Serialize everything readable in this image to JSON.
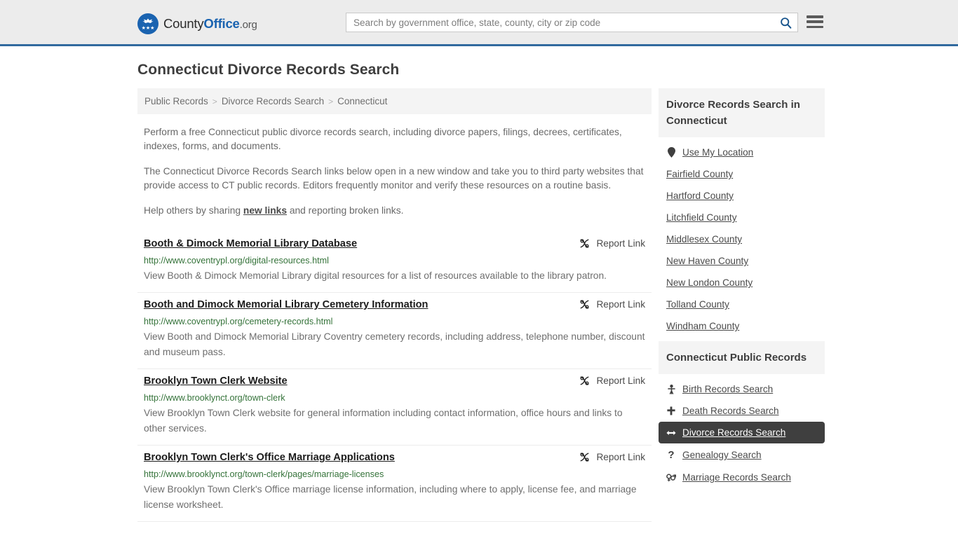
{
  "header": {
    "brand": {
      "part1": "County",
      "part2": "Office",
      "part3": ".org",
      "logo_icon": "eagle-shield-logo"
    },
    "search": {
      "placeholder": "Search by government office, state, county, city or zip code",
      "value": "",
      "search_icon": "search-icon"
    },
    "menu_icon": "hamburger-menu-icon",
    "accent_color": "#31699e",
    "bg_color": "#ececec"
  },
  "main": {
    "page_title": "Connecticut Divorce Records Search",
    "breadcrumb": [
      {
        "label": "Public Records"
      },
      {
        "label": "Divorce Records Search"
      },
      {
        "label": "Connecticut"
      }
    ],
    "breadcrumb_separator": ">",
    "intro_paragraphs": [
      "Perform a free Connecticut public divorce records search, including divorce papers, filings, decrees, certificates, indexes, forms, and documents.",
      "The Connecticut Divorce Records Search links below open in a new window and take you to third party websites that provide access to CT public records. Editors frequently monitor and verify these resources on a routine basis."
    ],
    "help_text_before": "Help others by sharing ",
    "help_link": "new links",
    "help_text_after": " and reporting broken links.",
    "report_link_label": "Report Link",
    "report_link_icon": "broken-link-icon",
    "url_color": "#35733a",
    "results": [
      {
        "title": "Booth & Dimock Memorial Library Database",
        "url": "http://www.coventrypl.org/digital-resources.html",
        "description": "View Booth & Dimock Memorial Library digital resources for a list of resources available to the library patron."
      },
      {
        "title": "Booth and Dimock Memorial Library Cemetery Information",
        "url": "http://www.coventrypl.org/cemetery-records.html",
        "description": "View Booth and Dimock Memorial Library Coventry cemetery records, including address, telephone number, discount and museum pass."
      },
      {
        "title": "Brooklyn Town Clerk Website",
        "url": "http://www.brooklynct.org/town-clerk",
        "description": "View Brooklyn Town Clerk website for general information including contact information, office hours and links to other services."
      },
      {
        "title": "Brooklyn Town Clerk's Office Marriage Applications",
        "url": "http://www.brooklynct.org/town-clerk/pages/marriage-licenses",
        "description": "View Brooklyn Town Clerk's Office marriage license information, including where to apply, license fee, and marriage license worksheet."
      }
    ]
  },
  "sidebar": {
    "counties_box": {
      "title": "Divorce Records Search in Connecticut",
      "items": [
        {
          "label": "Use My Location",
          "icon": "map-pin-icon",
          "active": false
        },
        {
          "label": "Fairfield County",
          "icon": "",
          "active": false
        },
        {
          "label": "Hartford County",
          "icon": "",
          "active": false
        },
        {
          "label": "Litchfield County",
          "icon": "",
          "active": false
        },
        {
          "label": "Middlesex County",
          "icon": "",
          "active": false
        },
        {
          "label": "New Haven County",
          "icon": "",
          "active": false
        },
        {
          "label": "New London County",
          "icon": "",
          "active": false
        },
        {
          "label": "Tolland County",
          "icon": "",
          "active": false
        },
        {
          "label": "Windham County",
          "icon": "",
          "active": false
        }
      ]
    },
    "records_box": {
      "title": "Connecticut Public Records",
      "active_color": "#3f3f3f",
      "items": [
        {
          "label": "Birth Records Search",
          "icon": "baby-icon",
          "active": false
        },
        {
          "label": "Death Records Search",
          "icon": "cross-icon",
          "active": false
        },
        {
          "label": "Divorce Records Search",
          "icon": "left-right-arrow-icon",
          "active": true
        },
        {
          "label": "Genealogy Search",
          "icon": "question-mark-icon",
          "active": false
        },
        {
          "label": "Marriage Records Search",
          "icon": "gender-symbols-icon",
          "active": false
        }
      ]
    }
  }
}
